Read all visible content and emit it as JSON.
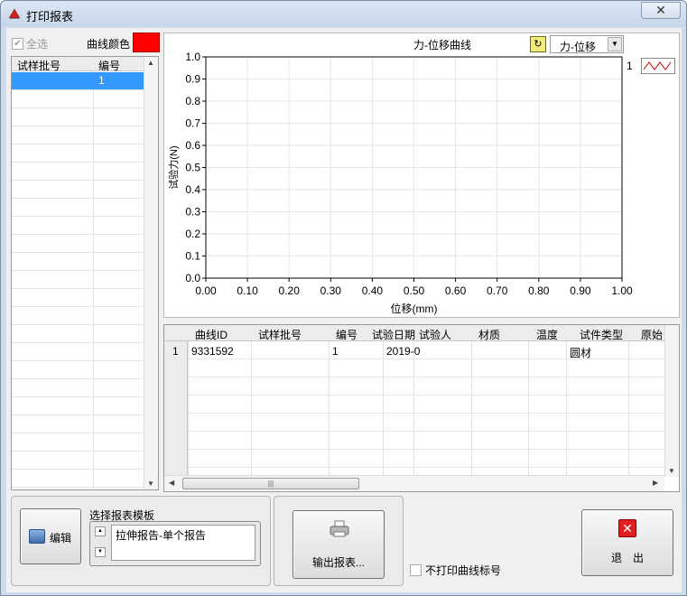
{
  "window": {
    "title": "打印报表",
    "close_glyph": "✕"
  },
  "left_panel": {
    "select_all_label": "全选",
    "curve_color_label": "曲线颜色",
    "curve_color": "#ff0000",
    "table": {
      "headers": [
        "试样批号",
        "编号"
      ],
      "rows": [
        {
          "batch": "",
          "number": "1"
        }
      ]
    }
  },
  "chart": {
    "title": "力-位移曲线",
    "selector_value": "力-位移",
    "legend_number": "1"
  },
  "chart_data": {
    "type": "line",
    "title": "力-位移曲线",
    "xlabel": "位移(mm)",
    "ylabel": "试验力(N)",
    "xlim": [
      0,
      1
    ],
    "ylim": [
      0,
      1
    ],
    "x_ticks": [
      "0.00",
      "0.10",
      "0.20",
      "0.30",
      "0.40",
      "0.50",
      "0.60",
      "0.70",
      "0.80",
      "0.90",
      "1.00"
    ],
    "y_ticks": [
      "0.0",
      "0.1",
      "0.2",
      "0.3",
      "0.4",
      "0.5",
      "0.6",
      "0.7",
      "0.8",
      "0.9",
      "1.0"
    ],
    "grid": true,
    "series": [
      {
        "name": "1",
        "color": "#cc0000",
        "x": [],
        "y": []
      }
    ]
  },
  "data_table": {
    "headers": [
      "曲线ID",
      "试样批号",
      "编号",
      "试验日期",
      "试验人",
      "材质",
      "温度",
      "试件类型",
      "原始"
    ],
    "rows": [
      {
        "index": "1",
        "cells": [
          "9331592",
          "",
          "1",
          "2019-0",
          "",
          "",
          "",
          "圆材",
          ""
        ]
      }
    ]
  },
  "bottom": {
    "edit_label": "编辑",
    "template_label": "选择报表模板",
    "template_value": "拉伸报告-单个报告",
    "export_label": "输出报表...",
    "no_print_label": "不打印曲线标号",
    "exit_label": "退出"
  }
}
